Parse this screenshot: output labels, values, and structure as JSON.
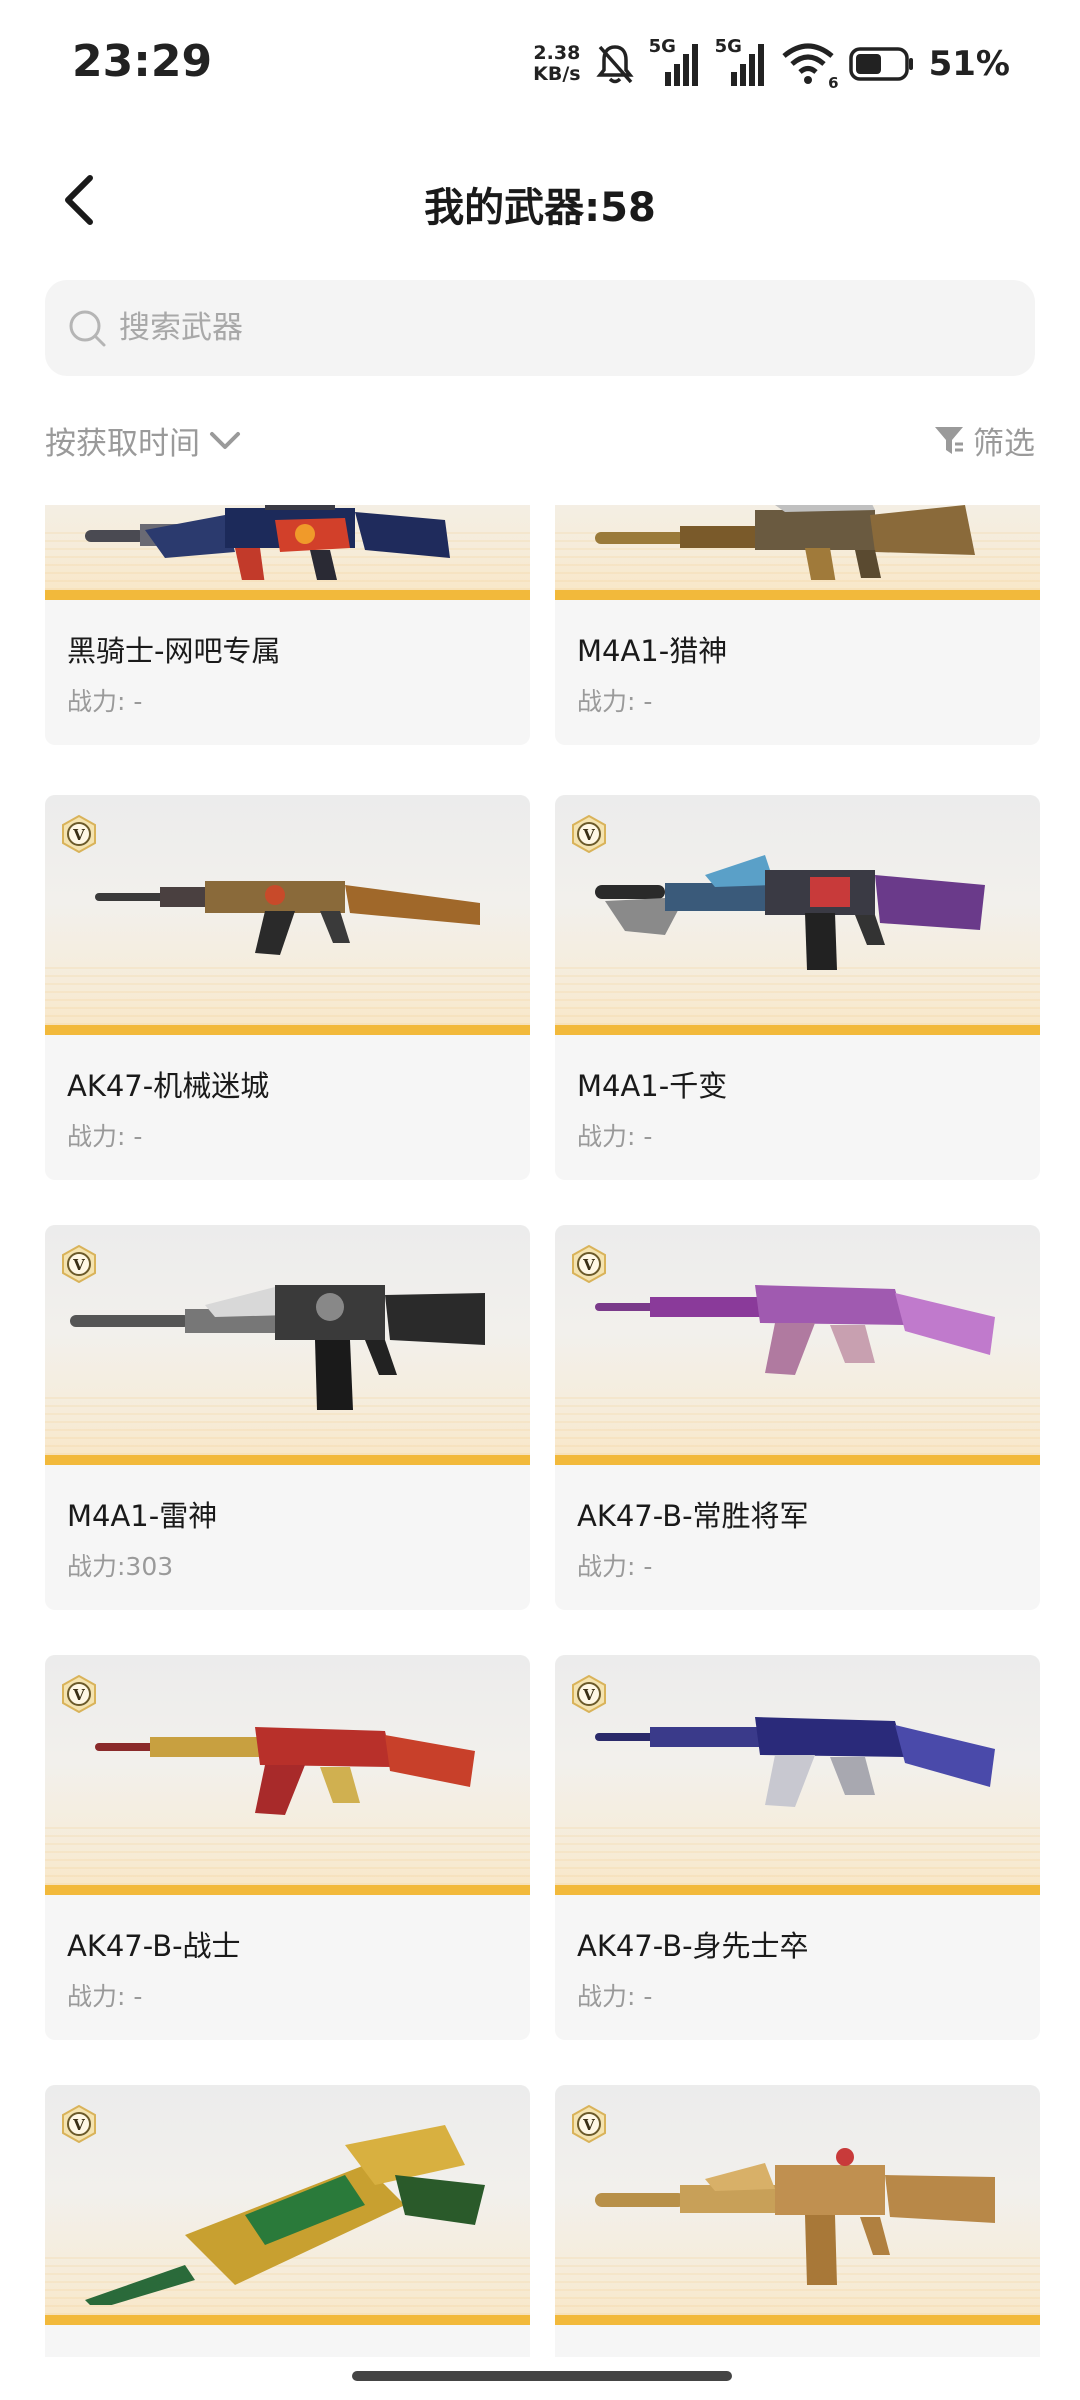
{
  "status_bar": {
    "time": "23:29",
    "net_speed_value": "2.38",
    "net_speed_unit": "KB/s",
    "sim1_label": "5G",
    "sim2_label": "5G",
    "wifi_badge": "6",
    "battery_percent": "51%",
    "icons": [
      "mute-bell-icon",
      "signal-icon",
      "signal-icon",
      "wifi-icon",
      "battery-icon"
    ]
  },
  "header": {
    "title": "我的武器:58",
    "back_icon": "chevron-left-icon"
  },
  "search": {
    "placeholder": "搜索武器",
    "value": ""
  },
  "sort": {
    "label": "按获取时间",
    "icon": "chevron-down-icon"
  },
  "filter": {
    "label": "筛选",
    "icon": "funnel-icon"
  },
  "accent_colors": {
    "card_stripe": "#f2b93b",
    "text_primary": "#1a1a1a",
    "text_secondary": "#9a9a9a"
  },
  "weapons": [
    {
      "name": "黑骑士-网吧专属",
      "power": "战力: -"
    },
    {
      "name": "M4A1-猎神",
      "power": "战力: -"
    },
    {
      "name": "AK47-机械迷城",
      "power": "战力: -"
    },
    {
      "name": "M4A1-千变",
      "power": "战力: -"
    },
    {
      "name": "M4A1-雷神",
      "power": "战力:303"
    },
    {
      "name": "AK47-B-常胜将军",
      "power": "战力: -"
    },
    {
      "name": "AK47-B-战士",
      "power": "战力: -"
    },
    {
      "name": "AK47-B-身先士卒",
      "power": "战力: -"
    },
    {
      "name": "",
      "power": ""
    },
    {
      "name": "",
      "power": ""
    }
  ]
}
